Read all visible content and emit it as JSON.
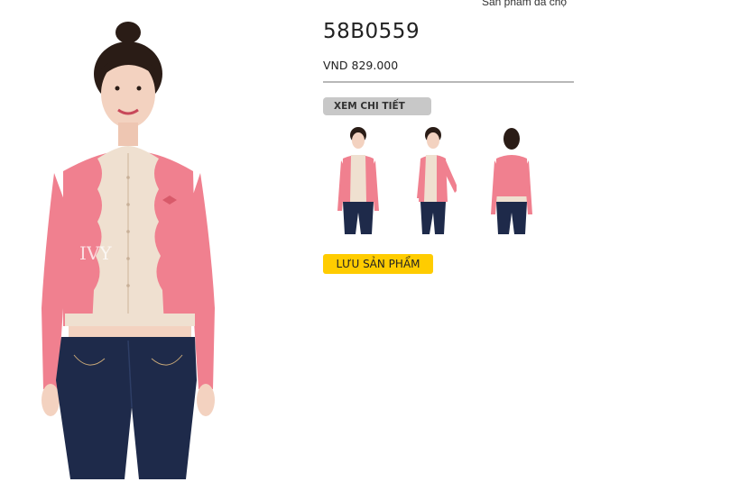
{
  "header": {
    "viewed_link": "Sản phẩm đã chọ"
  },
  "product": {
    "code": "58B0559",
    "price": "VND 829.000",
    "watermark": "IVY moda"
  },
  "actions": {
    "detail_label": "XEM CHI TIẾT",
    "save_label": "LƯU SẢN PHẨM"
  },
  "colors": {
    "cardigan_pink": "#f0808f",
    "cardigan_cream": "#efe0d0",
    "jeans_navy": "#1e2a4a",
    "save_button": "#ffcc00",
    "detail_button": "#c8c8c8"
  }
}
